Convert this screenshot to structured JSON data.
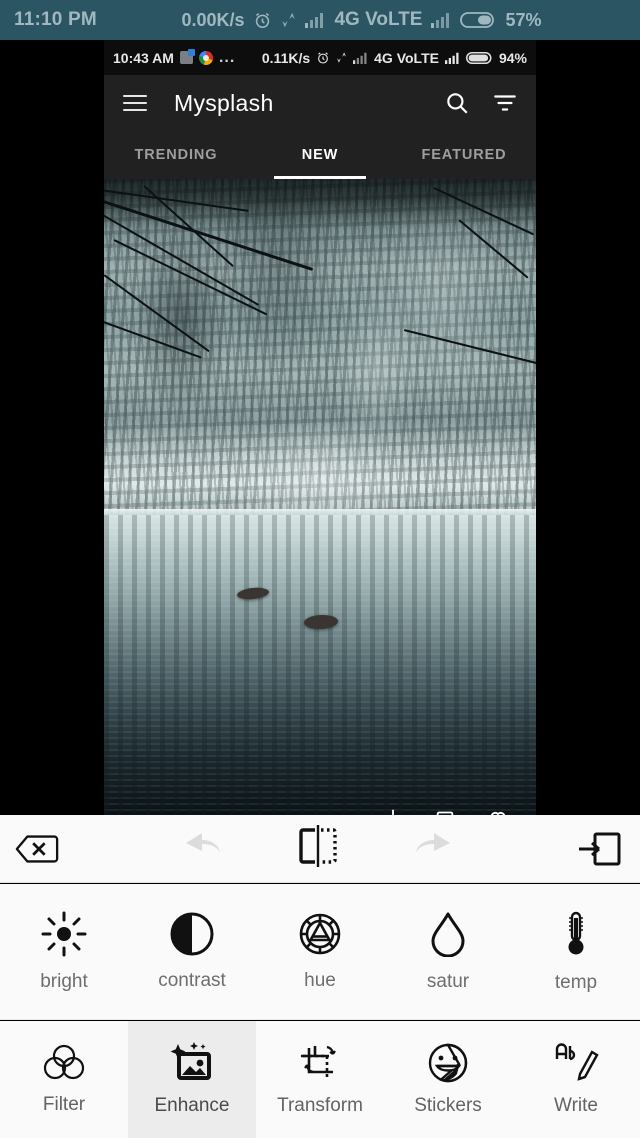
{
  "os_statusbar": {
    "time": "11:10 PM",
    "net_speed": "0.00K/s",
    "network": "4G VoLTE",
    "battery": "57%",
    "icons": [
      "alarm-icon",
      "data-transfer-icon",
      "signal-bars-icon",
      "signal-bars-icon",
      "battery-icon"
    ],
    "bg_color": "#2c5563",
    "text_color": "#9fb8c0"
  },
  "inner_screenshot": {
    "statusbar": {
      "time": "10:43 AM",
      "overflow": "...",
      "net_speed": "0.11K/s",
      "network": "4G VoLTE",
      "battery": "94%",
      "icons": [
        "notification-app-icon",
        "chrome-icon",
        "alarm-icon",
        "data-transfer-icon",
        "signal-bars-icon",
        "signal-bars-icon",
        "battery-icon"
      ]
    },
    "appbar": {
      "menu_icon": "hamburger-menu-icon",
      "title": "Mysplash",
      "search_icon": "search-icon",
      "filter_icon": "filter-icon",
      "bg_color": "#212121"
    },
    "tabs": [
      {
        "label": "TRENDING",
        "selected": false
      },
      {
        "label": "NEW",
        "selected": true
      },
      {
        "label": "FEATURED",
        "selected": false
      }
    ],
    "photo": {
      "description": "snowy winter forest lake with reflections",
      "action_icons": [
        "download-icon",
        "collection-icon",
        "heart-icon"
      ]
    }
  },
  "editor": {
    "toolbar": {
      "close_label": "close",
      "undo_label": "undo",
      "compare_label": "compare",
      "redo_label": "redo",
      "export_label": "export",
      "undo_enabled": false,
      "redo_enabled": false,
      "bg_color": "#fafafa"
    },
    "adjustments": [
      {
        "label": "bright",
        "icon": "sun-icon"
      },
      {
        "label": "contrast",
        "icon": "contrast-circle-icon"
      },
      {
        "label": "hue",
        "icon": "color-wheel-icon"
      },
      {
        "label": "satur",
        "icon": "droplet-icon"
      },
      {
        "label": "temp",
        "icon": "thermometer-icon"
      }
    ],
    "bottom_nav": [
      {
        "label": "Filter",
        "icon": "venn-circles-icon",
        "selected": false
      },
      {
        "label": "Enhance",
        "icon": "image-sparkle-icon",
        "selected": true
      },
      {
        "label": "Transform",
        "icon": "crop-rotate-icon",
        "selected": false
      },
      {
        "label": "Stickers",
        "icon": "smiley-sticker-icon",
        "selected": false
      },
      {
        "label": "Write",
        "icon": "ab-pencil-icon",
        "selected": false
      }
    ],
    "selected_nav": "Enhance",
    "accent_selected_bg": "#ececec"
  }
}
